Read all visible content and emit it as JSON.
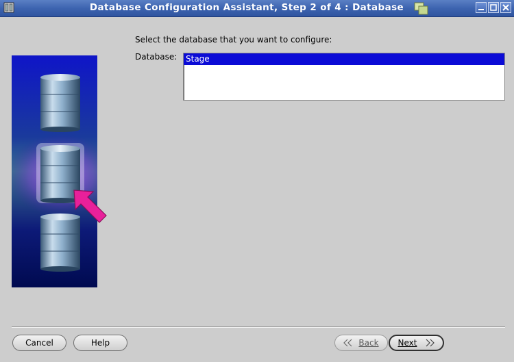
{
  "window": {
    "title": "Database Configuration Assistant, Step 2 of 4 : Database"
  },
  "content": {
    "prompt": "Select the database that you want to configure:",
    "database_label": "Database:",
    "databases": [
      {
        "name": "Stage",
        "selected": true
      }
    ]
  },
  "buttons": {
    "cancel": "Cancel",
    "help": "Help",
    "back": "Back",
    "next": "Next"
  },
  "colors": {
    "title_bar": "#3d64b0",
    "selection": "#0b0bd6",
    "arrow": "#e8209a"
  }
}
